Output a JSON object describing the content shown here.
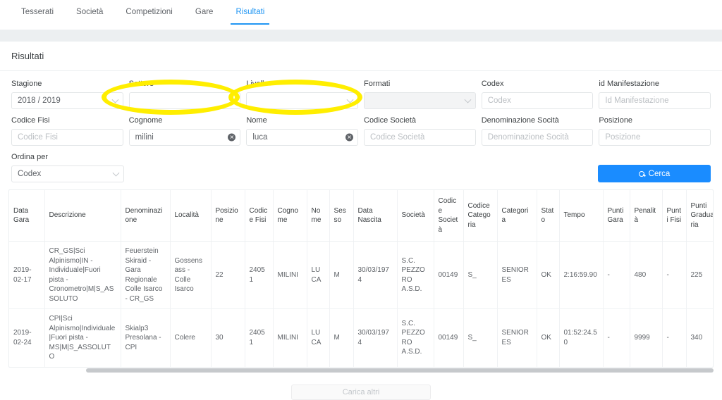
{
  "nav": {
    "tabs": [
      {
        "label": "Tesserati",
        "active": false
      },
      {
        "label": "Società",
        "active": false
      },
      {
        "label": "Competizioni",
        "active": false
      },
      {
        "label": "Gare",
        "active": false
      },
      {
        "label": "Risultati",
        "active": true
      }
    ]
  },
  "card": {
    "title": "Risultati"
  },
  "filters": {
    "row1": [
      {
        "label": "Stagione",
        "type": "select",
        "value": "2018 / 2019",
        "placeholder": "",
        "disabled": false
      },
      {
        "label": "Settore",
        "type": "select",
        "value": "",
        "placeholder": "",
        "disabled": false
      },
      {
        "label": "Livello",
        "type": "select",
        "value": "",
        "placeholder": "",
        "disabled": false
      },
      {
        "label": "Formati",
        "type": "select",
        "value": "",
        "placeholder": "",
        "disabled": true
      },
      {
        "label": "Codex",
        "type": "text",
        "value": "",
        "placeholder": "Codex",
        "disabled": false
      },
      {
        "label": "id Manifestazione",
        "type": "text",
        "value": "",
        "placeholder": "Id Manifestazione",
        "disabled": false
      }
    ],
    "row2": [
      {
        "label": "Codice Fisi",
        "type": "text",
        "value": "",
        "placeholder": "Codice Fisi",
        "disabled": false,
        "clearable": false
      },
      {
        "label": "Cognome",
        "type": "text",
        "value": "milini",
        "placeholder": "Cognome",
        "disabled": false,
        "clearable": true
      },
      {
        "label": "Nome",
        "type": "text",
        "value": "luca",
        "placeholder": "Nome",
        "disabled": false,
        "clearable": true
      },
      {
        "label": "Codice Società",
        "type": "text",
        "value": "",
        "placeholder": "Codice Società",
        "disabled": false,
        "clearable": false
      },
      {
        "label": "Denominazione Socità",
        "type": "text",
        "value": "",
        "placeholder": "Denominazione Socità",
        "disabled": false,
        "clearable": false
      },
      {
        "label": "Posizione",
        "type": "text",
        "value": "",
        "placeholder": "Posizione",
        "disabled": false,
        "clearable": false
      }
    ],
    "sort": {
      "label": "Ordina per",
      "value": "Codex"
    },
    "search_button": {
      "label": "Cerca",
      "icon": "search-icon",
      "color": "#1a8cff"
    },
    "clear_icon_label": "✕"
  },
  "annotations": {
    "ellipses": [
      {
        "name": "highlight-cognome",
        "color": "#ffee00"
      },
      {
        "name": "highlight-nome",
        "color": "#ffee00"
      }
    ]
  },
  "table": {
    "columns": [
      "Data Gara",
      "Descrizione",
      "Denominazione",
      "Località",
      "Posizione",
      "Codice Fisi",
      "Cognome",
      "Nome",
      "Sesso",
      "Data Nascita",
      "Società",
      "Codice Società",
      "Codice Categoria",
      "Categoria",
      "Stato",
      "Tempo",
      "Punti Gara",
      "Penalità",
      "Punti Fisi",
      "Punti Graduatoria"
    ],
    "rows": [
      [
        "2019-02-17",
        "CR_GS|Sci Alpinismo|IN - Individuale|Fuori pista - Cronometro|M|S_ASSOLUTO",
        "Feuerstein Skiraid - Gara Regionale Colle Isarco - CR_GS",
        "Gossensass - Colle Isarco",
        "22",
        "24051",
        "MILINI",
        "LUCA",
        "M",
        "30/03/1974",
        "S.C. PEZZORO A.S.D.",
        "00149",
        "S_",
        "SENIORES",
        "OK",
        "2:16:59.90",
        "-",
        "480",
        "-",
        "225"
      ],
      [
        "2019-02-24",
        "CPI|Sci Alpinismo|Individuale|Fuori pista - MS|M|S_ASSOLUTO",
        "Skialp3 Presolana - CPI",
        "Colere",
        "30",
        "24051",
        "MILINI",
        "LUCA",
        "M",
        "30/03/1974",
        "S.C. PEZZORO A.S.D.",
        "00149",
        "S_",
        "SENIORES",
        "OK",
        "01:52:24.50",
        "-",
        "9999",
        "-",
        "340"
      ]
    ]
  },
  "footer": {
    "load_more_label": "Carica altri"
  }
}
